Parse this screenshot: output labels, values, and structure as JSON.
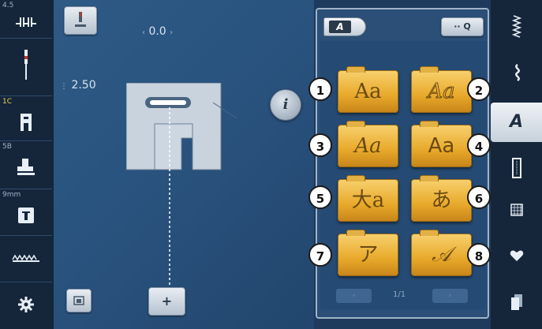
{
  "left_toolbar": {
    "needle_position_value": "4.5",
    "stitch_length_value": "1C",
    "presser_foot_value": "5B",
    "foot_indicator_value": "9mm"
  },
  "main": {
    "stitch_width_value": "0.0",
    "stitch_length_value": "2.50",
    "info_label": "i",
    "plus_label": "+"
  },
  "panel": {
    "tab_label": "A",
    "zoom_label": "·· Q",
    "page_indicator": "1/1",
    "fonts": [
      {
        "number": "1",
        "sample": "Aa"
      },
      {
        "number": "2",
        "sample": "Aa"
      },
      {
        "number": "3",
        "sample": "Aa"
      },
      {
        "number": "4",
        "sample": "Aa"
      },
      {
        "number": "5",
        "sample": "大a"
      },
      {
        "number": "6",
        "sample": "あ"
      },
      {
        "number": "7",
        "sample": "ア"
      },
      {
        "number": "8",
        "sample": "𝒜"
      }
    ]
  },
  "right_toolbar": {
    "alphabet_label": "A"
  }
}
